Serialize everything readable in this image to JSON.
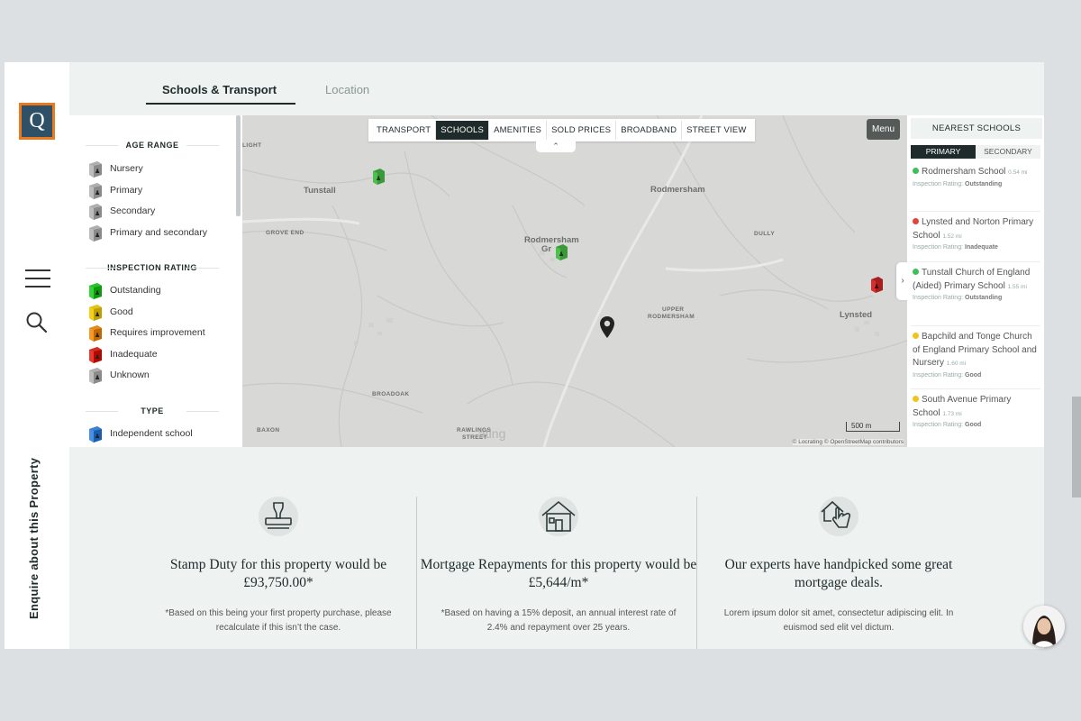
{
  "tabs": {
    "schools_transport": "Schools & Transport",
    "location": "Location"
  },
  "logo": {
    "letter": "Q"
  },
  "rail": {
    "enquire_label": "Enquire about this Property"
  },
  "legend": {
    "age_range_title": "AGE RANGE",
    "age_range": [
      {
        "label": "Nursery",
        "icon": "building-icon",
        "color": "#bdbdbd"
      },
      {
        "label": "Primary",
        "icon": "building-icon",
        "color": "#bdbdbd"
      },
      {
        "label": "Secondary",
        "icon": "building-icon",
        "color": "#bdbdbd"
      },
      {
        "label": "Primary and secondary",
        "icon": "building-icon",
        "color": "#bdbdbd"
      }
    ],
    "inspection_title": "INSPECTION RATING",
    "inspection": [
      {
        "label": "Outstanding",
        "color": "#3ccf3c"
      },
      {
        "label": "Good",
        "color": "#f2d11a"
      },
      {
        "label": "Requires improvement",
        "color": "#f59a26"
      },
      {
        "label": "Inadequate",
        "color": "#e53a2f"
      },
      {
        "label": "Unknown",
        "color": "#bdbdbd"
      }
    ],
    "type_title": "TYPE",
    "type": [
      {
        "label": "Independent school",
        "color": "#4a90e2"
      }
    ]
  },
  "map": {
    "toolbar": [
      "TRANSPORT",
      "SCHOOLS",
      "AMENITIES",
      "SOLD PRICES",
      "BROADBAND",
      "STREET VIEW"
    ],
    "active_tool": "SCHOOLS",
    "menu_label": "Menu",
    "places": {
      "light": "LIGHT",
      "tunstall": "Tunstall",
      "grove_end": "GROVE END",
      "rodmersham": "Rodmersham",
      "rodmersham_green_1": "Rodmersham",
      "rodmersham_green_2": "Gr",
      "dully": "DULLY",
      "upper_rodmersham_1": "UPPER",
      "upper_rodmersham_2": "RODMERSHAM",
      "lynsted": "Lynsted",
      "broadoak": "BROADOAK",
      "baxon": "BAXON",
      "rawlings_1": "RAWLINGS",
      "rawlings_2": "STREET"
    },
    "watermark": "ating",
    "scale": "500 m",
    "attribution": "© Locrating © OpenStreetMap contributors"
  },
  "schools": {
    "title": "NEAREST SCHOOLS",
    "tab_primary": "PRIMARY",
    "tab_secondary": "SECONDARY",
    "items": [
      {
        "name": "Rodmersham School",
        "dist": "0.54 mi",
        "rating_label": "Inspection Rating:",
        "rating": "Outstanding",
        "color": "#3fbf5a"
      },
      {
        "name": "Lynsted and Norton Primary School",
        "dist": "1.52 mi",
        "rating_label": "Inspection Rating:",
        "rating": "Inadequate",
        "color": "#e0443a"
      },
      {
        "name": "Tunstall Church of England (Aided) Primary School",
        "dist": "1.55 mi",
        "rating_label": "Inspection Rating:",
        "rating": "Outstanding",
        "color": "#3fbf5a"
      },
      {
        "name": "Bapchild and Tonge Church of England Primary School and Nursery",
        "dist": "1.60 mi",
        "rating_label": "Inspection Rating:",
        "rating": "Good",
        "color": "#f2c318"
      },
      {
        "name": "South Avenue Primary School",
        "dist": "1.73 mi",
        "rating_label": "Inspection Rating:",
        "rating": "Good",
        "color": "#f2c318"
      }
    ]
  },
  "cards": [
    {
      "icon": "stamp-icon",
      "title": "Stamp Duty for this property would be £93,750.00*",
      "text": "*Based on this being your first property purchase, please recalculate if this isn’t the case."
    },
    {
      "icon": "house-icon",
      "title": "Mortgage Repayments for this property would be £5,644/m*",
      "text": "*Based on having a 15% deposit, an annual interest rate of 2.4% and repayment over 25 years."
    },
    {
      "icon": "house-hand-icon",
      "title": "Our experts have handpicked some great mortgage deals.",
      "text": "Lorem ipsum dolor sit amet, consectetur adipiscing elit. In euismod sed elit vel dictum."
    }
  ]
}
